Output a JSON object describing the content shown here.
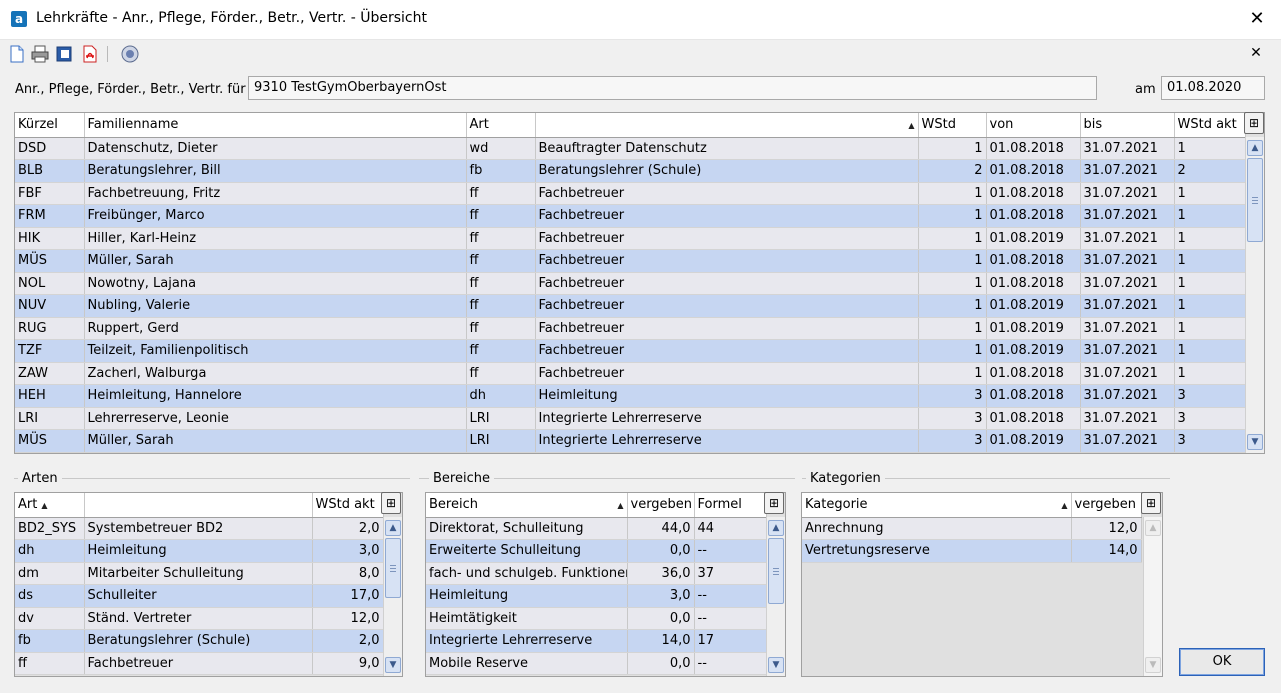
{
  "window": {
    "title": "Lehrkräfte - Anr., Pflege, Förder., Betr., Vertr. - Übersicht",
    "app_icon": "a",
    "close_symbol": "✕"
  },
  "toolbar": {
    "icons": [
      "new-document-icon",
      "print-icon",
      "word-export-icon",
      "pdf-export-icon",
      "help-icon"
    ],
    "panel_close_symbol": "✕"
  },
  "header": {
    "label": "Anr., Pflege, Förder., Betr., Vertr.  für",
    "school": "9310 TestGymOberbayernOst",
    "date_label": "am",
    "date": "01.08.2020"
  },
  "main_table": {
    "columns": [
      "Kürzel",
      "Familienname",
      "Art",
      "",
      "WStd",
      "von",
      "bis",
      "WStd akt"
    ],
    "rows": [
      [
        "DSD",
        "Datenschutz, Dieter",
        "wd",
        "Beauftragter Datenschutz",
        "1",
        "01.08.2018",
        "31.07.2021",
        "1"
      ],
      [
        "BLB",
        "Beratungslehrer, Bill",
        "fb",
        "Beratungslehrer (Schule)",
        "2",
        "01.08.2018",
        "31.07.2021",
        "2"
      ],
      [
        "FBF",
        "Fachbetreuung, Fritz",
        "ff",
        "Fachbetreuer",
        "1",
        "01.08.2018",
        "31.07.2021",
        "1"
      ],
      [
        "FRM",
        "Freibünger, Marco",
        "ff",
        "Fachbetreuer",
        "1",
        "01.08.2018",
        "31.07.2021",
        "1"
      ],
      [
        "HIK",
        "Hiller, Karl-Heinz",
        "ff",
        "Fachbetreuer",
        "1",
        "01.08.2019",
        "31.07.2021",
        "1"
      ],
      [
        "MÜS",
        "Müller, Sarah",
        "ff",
        "Fachbetreuer",
        "1",
        "01.08.2018",
        "31.07.2021",
        "1"
      ],
      [
        "NOL",
        "Nowotny, Lajana",
        "ff",
        "Fachbetreuer",
        "1",
        "01.08.2018",
        "31.07.2021",
        "1"
      ],
      [
        "NUV",
        "Nubling, Valerie",
        "ff",
        "Fachbetreuer",
        "1",
        "01.08.2019",
        "31.07.2021",
        "1"
      ],
      [
        "RUG",
        "Ruppert, Gerd",
        "ff",
        "Fachbetreuer",
        "1",
        "01.08.2019",
        "31.07.2021",
        "1"
      ],
      [
        "TZF",
        "Teilzeit, Familienpolitisch",
        "ff",
        "Fachbetreuer",
        "1",
        "01.08.2019",
        "31.07.2021",
        "1"
      ],
      [
        "ZAW",
        "Zacherl, Walburga",
        "ff",
        "Fachbetreuer",
        "1",
        "01.08.2018",
        "31.07.2021",
        "1"
      ],
      [
        "HEH",
        "Heimleitung, Hannelore",
        "dh",
        "Heimleitung",
        "3",
        "01.08.2018",
        "31.07.2021",
        "3"
      ],
      [
        "LRI",
        "Lehrerreserve, Leonie",
        "LRI",
        "Integrierte Lehrerreserve",
        "3",
        "01.08.2018",
        "31.07.2021",
        "3"
      ],
      [
        "MÜS",
        "Müller, Sarah",
        "LRI",
        "Integrierte Lehrerreserve",
        "3",
        "01.08.2019",
        "31.07.2021",
        "3"
      ]
    ]
  },
  "arten": {
    "title": "Arten",
    "columns": [
      "Art",
      "",
      "WStd akt"
    ],
    "rows": [
      [
        "BD2_SYS",
        "Systembetreuer BD2",
        "2,0"
      ],
      [
        "dh",
        "Heimleitung",
        "3,0"
      ],
      [
        "dm",
        "Mitarbeiter Schulleitung",
        "8,0"
      ],
      [
        "ds",
        "Schulleiter",
        "17,0"
      ],
      [
        "dv",
        "Ständ. Vertreter",
        "12,0"
      ],
      [
        "fb",
        "Beratungslehrer (Schule)",
        "2,0"
      ],
      [
        "ff",
        "Fachbetreuer",
        "9,0"
      ]
    ]
  },
  "bereiche": {
    "title": "Bereiche",
    "columns": [
      "Bereich",
      "vergeben",
      "Formel"
    ],
    "rows": [
      [
        "Direktorat, Schulleitung",
        "44,0",
        "44"
      ],
      [
        "Erweiterte Schulleitung",
        "0,0",
        "--"
      ],
      [
        "fach- und schulgeb. Funktionen",
        "36,0",
        "37"
      ],
      [
        "Heimleitung",
        "3,0",
        "--"
      ],
      [
        "Heimtätigkeit",
        "0,0",
        "--"
      ],
      [
        "Integrierte Lehrerreserve",
        "14,0",
        "17"
      ],
      [
        "Mobile Reserve",
        "0,0",
        "--"
      ]
    ]
  },
  "kategorien": {
    "title": "Kategorien",
    "columns": [
      "Kategorie",
      "vergeben"
    ],
    "rows": [
      [
        "Anrechnung",
        "12,0"
      ],
      [
        "Vertretungsreserve",
        "14,0"
      ]
    ]
  },
  "buttons": {
    "ok": "OK"
  },
  "colors": {
    "row_odd": "#e8e8ee",
    "row_even": "#c6d6f2",
    "accent": "#2c62b8"
  }
}
